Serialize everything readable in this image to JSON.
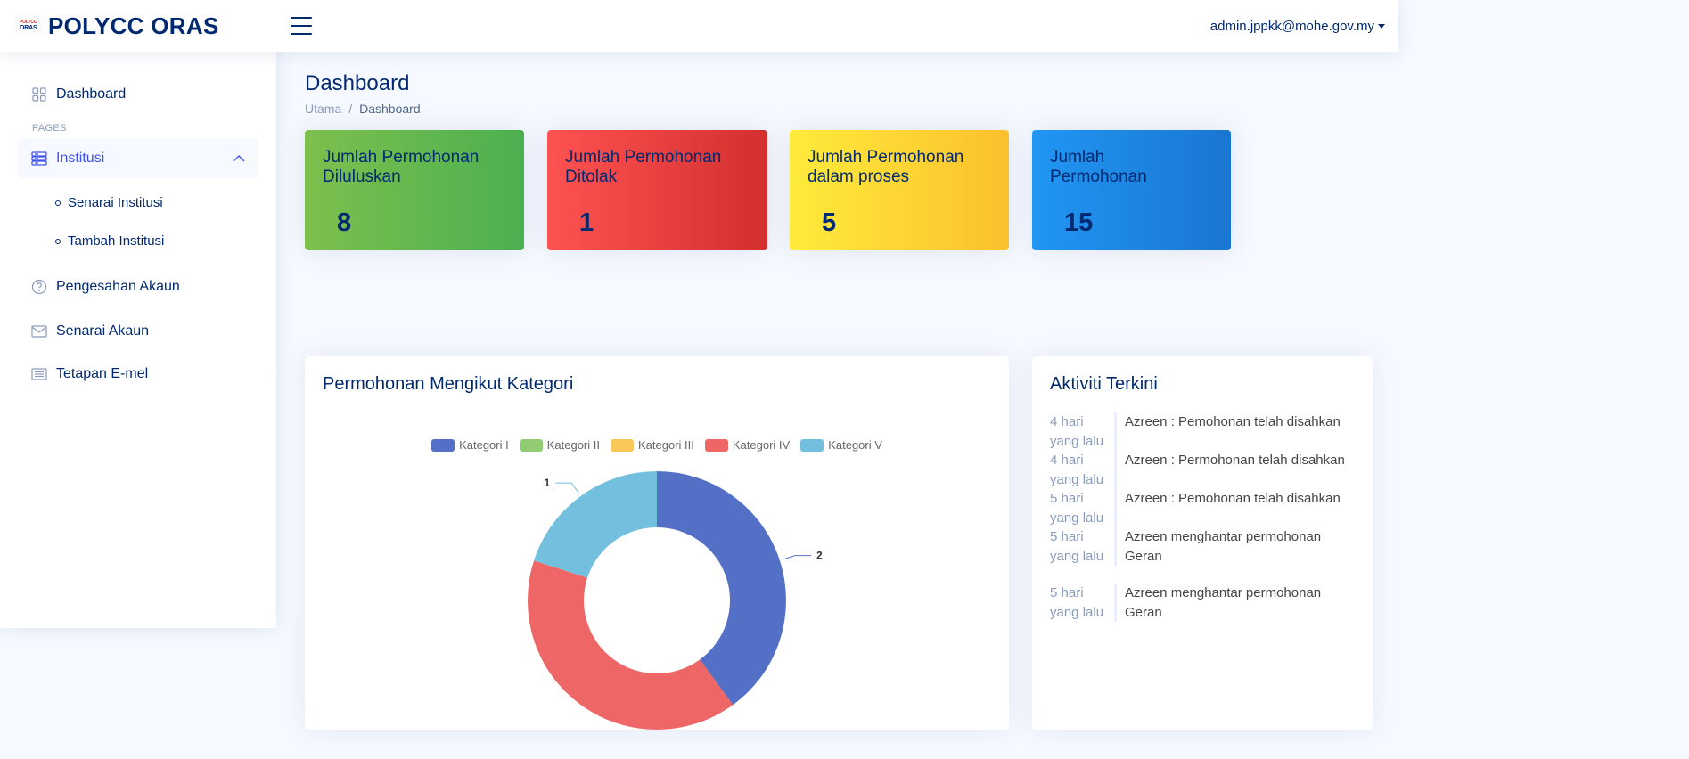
{
  "header": {
    "logo_line1": "POLYCC",
    "logo_line2": "ORAS",
    "app_title": "POLYCC ORAS",
    "user_email": "admin.jppkk@mohe.gov.my"
  },
  "sidebar": {
    "dashboard": "Dashboard",
    "section_heading": "PAGES",
    "institusi": "Institusi",
    "sub_items": [
      "Senarai Institusi",
      "Tambah Institusi"
    ],
    "pengesahan": "Pengesahan Akaun",
    "senarai_akaun": "Senarai Akaun",
    "tetapan": "Tetapan E-mel"
  },
  "page": {
    "title": "Dashboard",
    "breadcrumb": [
      "Utama",
      "Dashboard"
    ]
  },
  "cards": [
    {
      "title": "Jumlah Permohonan Diluluskan",
      "value": "8"
    },
    {
      "title": "Jumlah Permohonan Ditolak",
      "value": "1"
    },
    {
      "title": "Jumlah Permohonan dalam proses",
      "value": "5"
    },
    {
      "title": "Jumlah Permohonan",
      "value": "15"
    }
  ],
  "chart_panel": {
    "title": "Permohonan Mengikut Kategori"
  },
  "chart_data": {
    "type": "pie",
    "categories": [
      "Kategori I",
      "Kategori II",
      "Kategori III",
      "Kategori IV",
      "Kategori V"
    ],
    "values": [
      2,
      0,
      0,
      2,
      1
    ],
    "colors": [
      "#5470c6",
      "#91cc75",
      "#fac858",
      "#ee6666",
      "#73c0de"
    ],
    "data_labels": [
      "2",
      "",
      "",
      "",
      "1"
    ]
  },
  "activity": {
    "title": "Aktiviti Terkini",
    "items": [
      {
        "time_line1": "4 hari",
        "time_line2": "yang lalu",
        "text": "Azreen : Pemohonan telah disahkan"
      },
      {
        "time_line1": "4 hari",
        "time_line2": "yang lalu",
        "text": "Azreen : Permohonan telah disahkan"
      },
      {
        "time_line1": "5 hari",
        "time_line2": "yang lalu",
        "text": "Azreen : Pemohonan telah disahkan"
      },
      {
        "time_line1": "5 hari",
        "time_line2": "yang lalu",
        "text": "Azreen menghantar permohonan Geran"
      },
      {
        "time_line1": "5 hari",
        "time_line2": "yang lalu",
        "text": "Azreen menghantar permohonan Geran"
      }
    ]
  }
}
